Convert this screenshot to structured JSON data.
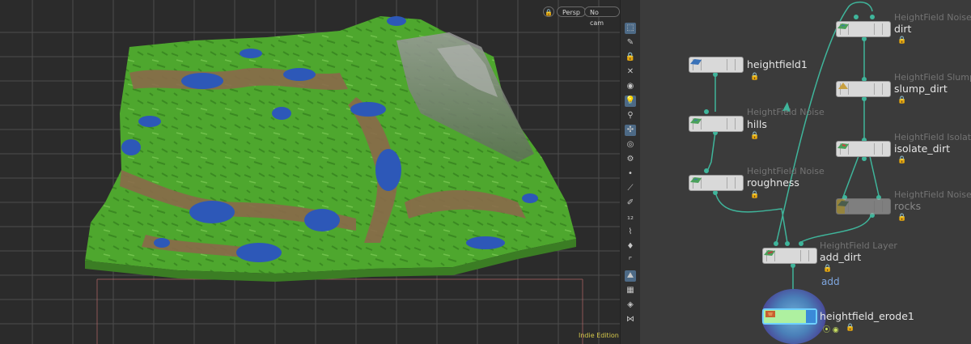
{
  "viewport": {
    "lock_icon": "lock-icon",
    "persp_label": "Persp",
    "camera_label": "No cam",
    "edition": "Indie Edition"
  },
  "toolbar": {
    "tools": [
      {
        "name": "select-tool-icon",
        "glyph": "⬚",
        "active": true
      },
      {
        "name": "handle-tool-icon",
        "glyph": "✎",
        "active": false
      },
      {
        "name": "lock-tool-icon",
        "glyph": "🔒",
        "active": false
      },
      {
        "name": "close-tool-icon",
        "glyph": "✕",
        "active": false
      },
      {
        "name": "sphere-tool-icon",
        "glyph": "◉",
        "active": false
      },
      {
        "name": "light-tool-icon",
        "glyph": "💡",
        "active": true
      },
      {
        "name": "pin-tool-icon",
        "glyph": "⚲",
        "active": false
      },
      {
        "name": "globe-tool-icon",
        "glyph": "✣",
        "active": true
      },
      {
        "name": "eye-tool-icon",
        "glyph": "◎",
        "active": false
      },
      {
        "name": "gear-tool-icon",
        "glyph": "⚙",
        "active": false
      },
      {
        "name": "point-tool-icon",
        "glyph": "•",
        "active": false
      },
      {
        "name": "ruler-tool-icon",
        "glyph": "⟋",
        "active": false
      },
      {
        "name": "pen-tool-icon",
        "glyph": "✐",
        "active": false
      },
      {
        "name": "number-tool-icon",
        "glyph": "₁₂",
        "active": false
      },
      {
        "name": "brush-tool-icon",
        "glyph": "⌇",
        "active": false
      },
      {
        "name": "paint-tool-icon",
        "glyph": "♦",
        "active": false
      },
      {
        "name": "frame-tool-icon",
        "glyph": "⌜",
        "active": false
      },
      {
        "name": "terrain-tool-icon",
        "glyph": "⛰",
        "active": true
      },
      {
        "name": "grid-tool-icon",
        "glyph": "▦",
        "active": false
      },
      {
        "name": "diamond-tool-icon",
        "glyph": "◈",
        "active": false
      },
      {
        "name": "path-tool-icon",
        "glyph": "⋈",
        "active": false
      }
    ]
  },
  "network": {
    "nodes": [
      {
        "id": "heightfield1",
        "name": "heightfield1",
        "type": ""
      },
      {
        "id": "hills",
        "name": "hills",
        "type": "HeightField Noise"
      },
      {
        "id": "roughness",
        "name": "roughness",
        "type": "HeightField Noise"
      },
      {
        "id": "dirt",
        "name": "dirt",
        "type": "HeightField Noise"
      },
      {
        "id": "slump_dirt",
        "name": "slump_dirt",
        "type": "HeightField Slump"
      },
      {
        "id": "isolate_dirt",
        "name": "isolate_dirt",
        "type": "HeightField Isolate"
      },
      {
        "id": "rocks",
        "name": "rocks",
        "type": "HeightField Noise"
      },
      {
        "id": "add_dirt",
        "name": "add_dirt",
        "type": "HeightField Layer",
        "sublabel": "add"
      },
      {
        "id": "erode",
        "name": "heightfield_erode1",
        "type": ""
      }
    ]
  },
  "colors": {
    "terrain_green": "#4fae2e",
    "terrain_brown": "#8a6a4a",
    "terrain_water": "#2d58b8",
    "wire": "#3fb59b",
    "bypass": "#e0c040",
    "selected": "#6fd0ff"
  }
}
